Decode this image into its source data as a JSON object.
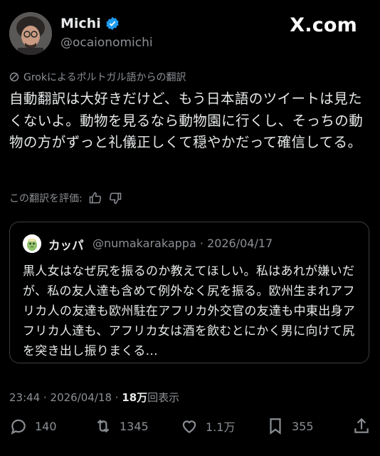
{
  "author": {
    "name": "Michi",
    "handle": "@ocaionomichi"
  },
  "site": "X.com",
  "translation": {
    "source_note": "Grokによるポルトガル語からの翻訳",
    "text": "自動翻訳は大好きだけど、もう日本語のツイートは見たくないよ。動物を見るなら動物園に行くし、そっちの動物の方がずっと礼儀正しくて穏やかだって確信してる。",
    "rate_label": "この翻訳を評価:"
  },
  "quote": {
    "name": "カッパ",
    "handle_date": "@numakarakappa · 2026/04/17",
    "text": "黒人女はなぜ尻を振るのか教えてほしい。私はあれが嫌いだが、私の友人達も含めて例外なく尻を振る。欧州生まれアフリカ人の友達も欧州駐在アフリカ外交官の友達も中東出身アフリカ人達も、アフリカ女は酒を飲むとにかく男に向けて尻を突き出し振りまくる..."
  },
  "meta": {
    "time": "23:44 · 2026/04/18 · ",
    "views_count": "18万",
    "views_label": "回表示"
  },
  "actions": {
    "replies": "140",
    "reposts": "1345",
    "likes": "1.1万",
    "bookmarks": "355"
  },
  "colors": {
    "background": "#000000",
    "text": "#e7e9ea",
    "secondary": "#8b8f94",
    "verified": "#1d9bf0"
  },
  "icons": [
    "verified-badge-icon",
    "grok-icon",
    "thumbs-up-icon",
    "thumbs-down-icon",
    "reply-icon",
    "repost-icon",
    "like-icon",
    "bookmark-icon",
    "share-icon"
  ]
}
